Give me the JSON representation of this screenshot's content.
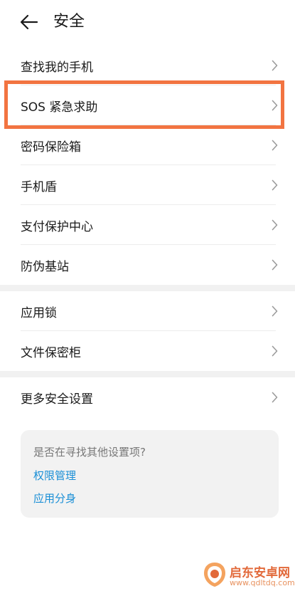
{
  "header": {
    "title": "安全"
  },
  "groups": [
    {
      "items": [
        {
          "label": "查找我的手机"
        },
        {
          "label": "SOS 紧急求助"
        },
        {
          "label": "密码保险箱"
        },
        {
          "label": "手机盾"
        },
        {
          "label": "支付保护中心"
        },
        {
          "label": "防伪基站"
        }
      ]
    },
    {
      "items": [
        {
          "label": "应用锁"
        },
        {
          "label": "文件保密柜"
        }
      ]
    },
    {
      "items": [
        {
          "label": "更多安全设置"
        }
      ]
    }
  ],
  "suggest": {
    "question": "是否在寻找其他设置项?",
    "links": [
      "权限管理",
      "应用分身"
    ]
  },
  "watermark": {
    "name": "启东安卓网",
    "url": "www.qdltdq.com"
  },
  "colors": {
    "highlight": "#f27441",
    "link": "#1a8fd6",
    "watermark": "#e2693a"
  },
  "icons": {
    "back": "back-arrow-icon",
    "chevron": "chevron-right-icon"
  }
}
